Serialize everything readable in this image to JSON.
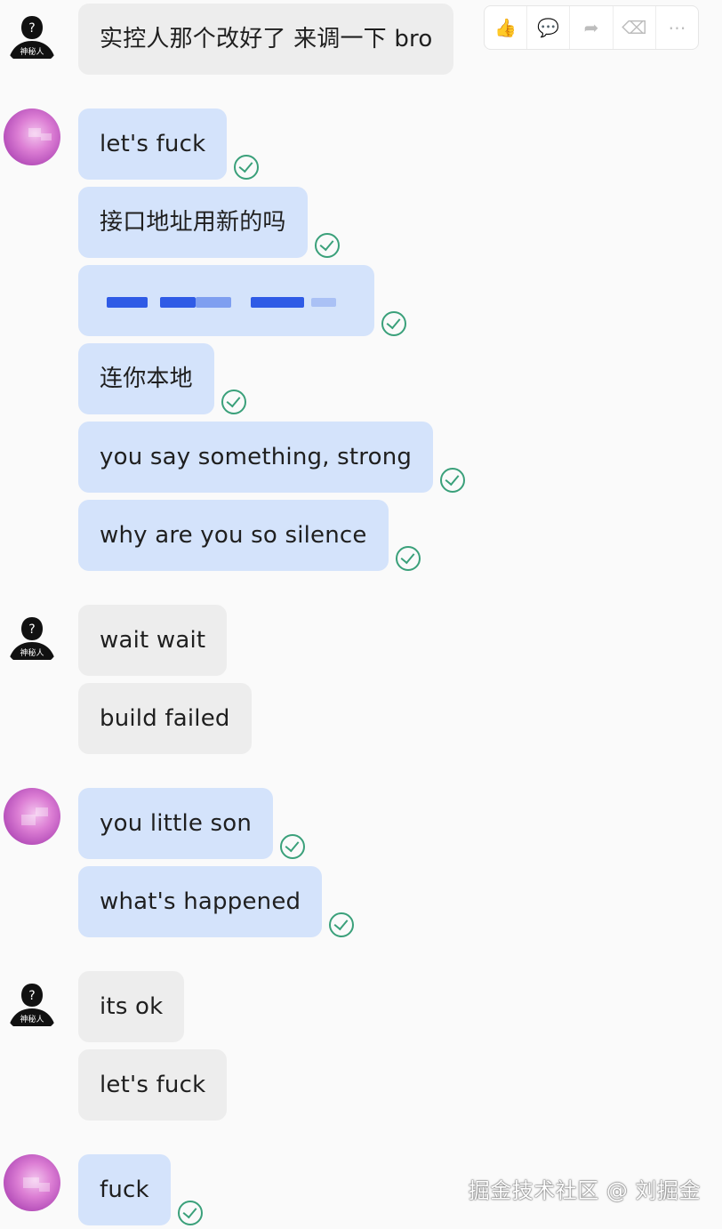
{
  "toolbar": {
    "buttons": [
      {
        "icon": "thumbs-up-icon"
      },
      {
        "icon": "comment-icon"
      },
      {
        "icon": "forward-icon"
      },
      {
        "icon": "delete-icon"
      },
      {
        "icon": "more-icon"
      }
    ],
    "glyphs": [
      "👍",
      "💬",
      "➦",
      "⌫",
      "⋯"
    ]
  },
  "avatar": {
    "mystery_caption": "神秘人",
    "mystery_mark": "?"
  },
  "messages": {
    "m1": "实控人那个改好了 来调一下 bro",
    "m2": "let's fuck",
    "m3": "接口地址用新的吗",
    "m5": "连你本地",
    "m6": "you say something, strong",
    "m7": "why are you so silence",
    "m8": "wait wait",
    "m9": "build failed",
    "m10": "you little son",
    "m11": "what's happened",
    "m12": "its ok",
    "m13": "let's fuck",
    "m14": "fuck"
  },
  "watermark": "掘金技术社区 @ 刘掘金",
  "colors": {
    "incoming_bubble": "#ededed",
    "outgoing_bubble": "#d4e3fb",
    "check": "#3aa07a"
  }
}
